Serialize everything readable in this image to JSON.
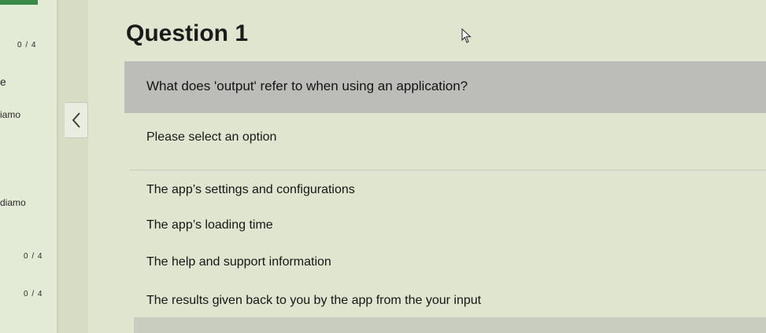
{
  "sidebar": {
    "items": [
      {
        "label": "0 / 4"
      },
      {
        "label": "e"
      },
      {
        "label": "iamo"
      },
      {
        "label": "diamo"
      },
      {
        "label": "0 / 4"
      },
      {
        "label": "0 / 4"
      }
    ]
  },
  "question": {
    "title": "Question 1",
    "text": "What does 'output' refer to when using an application?",
    "prompt": "Please select an option",
    "options": [
      "The app’s settings and configurations",
      "The app’s loading time",
      "The help and support information",
      "The results given back to you by the app from the your input"
    ]
  },
  "icons": {
    "collapse": "chevron-left-icon",
    "cursor": "mouse-pointer-icon"
  },
  "colors": {
    "accent": "#3a8a47",
    "question_bar": "#bcbcb8"
  }
}
